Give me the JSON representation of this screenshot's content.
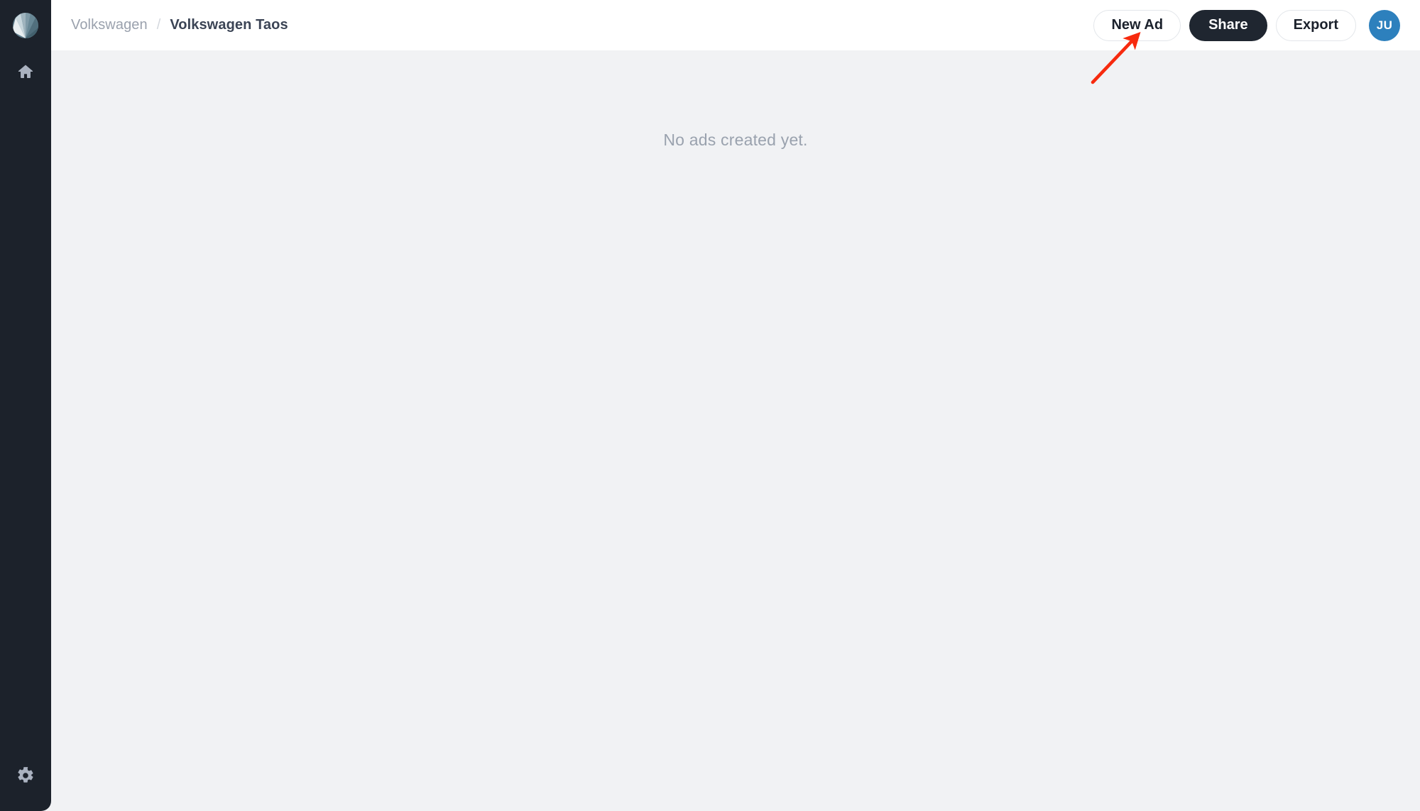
{
  "window": {
    "background_color": "#f1f2f4"
  },
  "sidebar": {
    "background_color": "#1c222b",
    "brand": {
      "name": "app-logo",
      "icon": "shell-fan-logo"
    },
    "items": [
      {
        "icon": "home-icon",
        "name": "home",
        "label": "Home"
      }
    ],
    "bottom_items": [
      {
        "icon": "gear-icon",
        "name": "settings",
        "label": "Settings"
      }
    ]
  },
  "topbar": {
    "background_color": "#ffffff",
    "breadcrumb": {
      "root": "Volkswagen",
      "separator": "/",
      "current": "Volkswagen Taos"
    },
    "actions": {
      "new_ad_label": "New Ad",
      "share_label": "Share",
      "export_label": "Export"
    },
    "avatar": {
      "initials": "JU",
      "color": "#2d80bd"
    }
  },
  "main": {
    "empty_state_text": "No ads created yet."
  },
  "annotation": {
    "arrow_color": "#f72a0e",
    "points_to": "New Ad"
  }
}
